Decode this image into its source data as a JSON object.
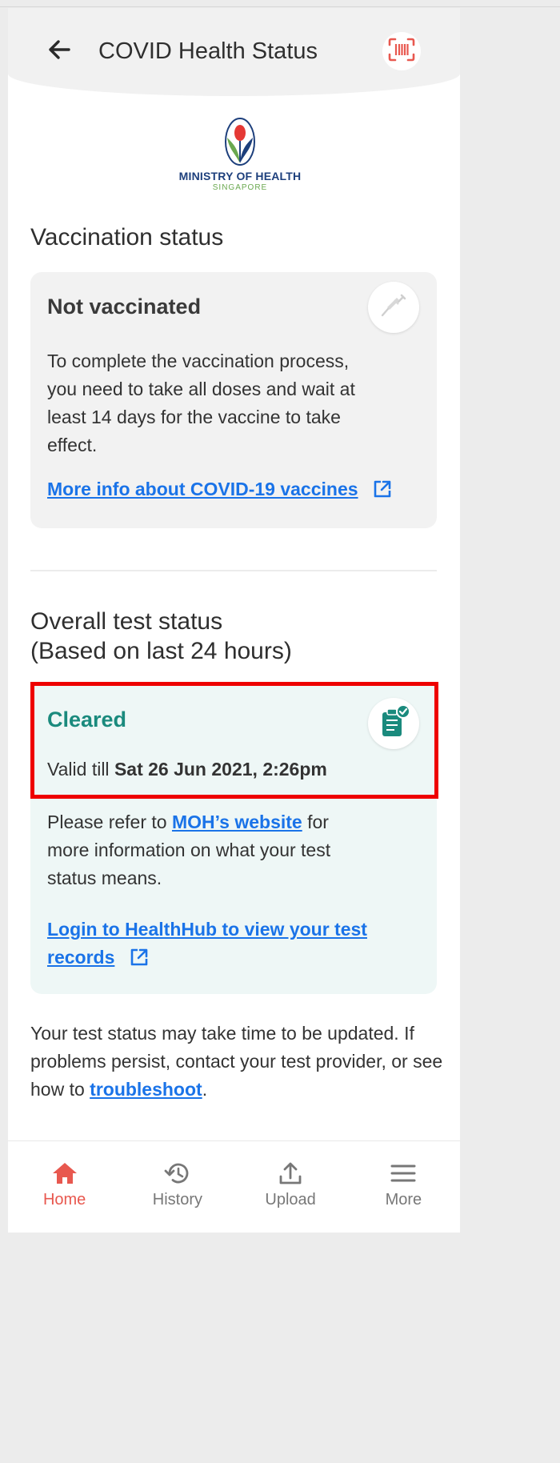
{
  "header": {
    "title": "COVID Health Status",
    "back_icon": "arrow-left-icon",
    "scan_icon": "barcode-scan-icon"
  },
  "logo": {
    "name": "MINISTRY OF HEALTH",
    "country": "SINGAPORE"
  },
  "vaccination": {
    "section_title": "Vaccination status",
    "status": "Not vaccinated",
    "description": "To complete the vaccination process, you need to take all doses and wait at least 14 days for the vaccine to take effect.",
    "link": "More info about COVID-19 vaccines",
    "icon": "syringe-icon"
  },
  "test": {
    "section_title_line1": "Overall test status",
    "section_title_line2": "(Based on last 24 hours)",
    "status": "Cleared",
    "valid_prefix": "Valid till",
    "valid_until": "Sat 26 Jun 2021, 2:26pm",
    "refer_prefix": "Please refer to",
    "refer_link": "MOH’s website",
    "refer_suffix": "for more information on what your test status means.",
    "login_link": "Login to HealthHub to view your test records",
    "icon": "clipboard-check-icon"
  },
  "footnote": {
    "text": "Your test status may take time to be updated. If problems persist, contact your test provider, or see how to",
    "link": "troubleshoot",
    "end": "."
  },
  "nav": {
    "items": [
      {
        "label": "Home",
        "icon": "home-icon",
        "active": true
      },
      {
        "label": "History",
        "icon": "history-icon",
        "active": false
      },
      {
        "label": "Upload",
        "icon": "upload-icon",
        "active": false
      },
      {
        "label": "More",
        "icon": "menu-icon",
        "active": false
      }
    ]
  },
  "colors": {
    "accent_red": "#e8584f",
    "cleared_green": "#1a8a7d",
    "link_blue": "#1a73e8",
    "highlight_border": "#ee0000"
  }
}
